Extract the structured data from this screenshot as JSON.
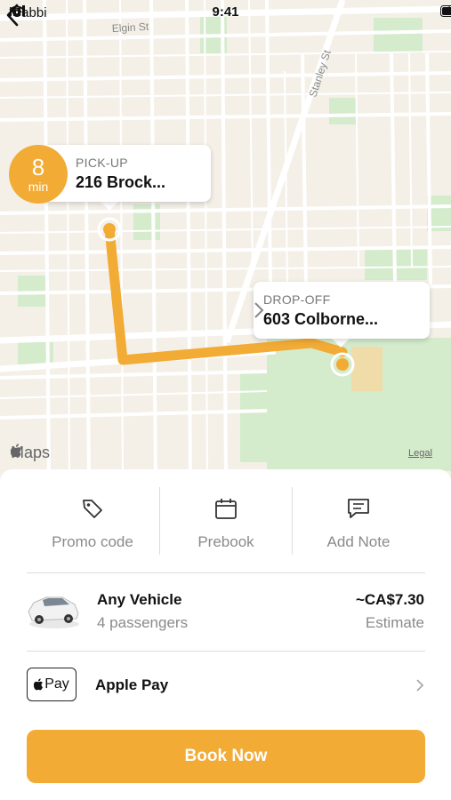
{
  "status_bar": {
    "carrier": "iCabbi",
    "time": "9:41"
  },
  "map": {
    "streets": [
      "Elgin St",
      "Stanley St"
    ],
    "eta": {
      "value": "8",
      "unit": "min"
    },
    "pickup": {
      "label": "PICK-UP",
      "address": "216 Brock..."
    },
    "dropoff": {
      "label": "DROP-OFF",
      "address": "603 Colborne..."
    },
    "attribution": "Maps",
    "legal": "Legal",
    "route_color": "#f2ab35"
  },
  "actions": [
    {
      "label": "Promo code",
      "icon": "tag-icon"
    },
    {
      "label": "Prebook",
      "icon": "calendar-icon"
    },
    {
      "label": "Add Note",
      "icon": "note-icon"
    }
  ],
  "vehicle": {
    "name": "Any Vehicle",
    "passengers": "4 passengers",
    "price": "~CA$7.30",
    "price_note": "Estimate"
  },
  "payment": {
    "badge": "Pay",
    "method": "Apple Pay"
  },
  "book_button": "Book Now",
  "colors": {
    "accent": "#f2ab35",
    "map_bg": "#f4f0e8",
    "park": "#cfe8c8"
  }
}
